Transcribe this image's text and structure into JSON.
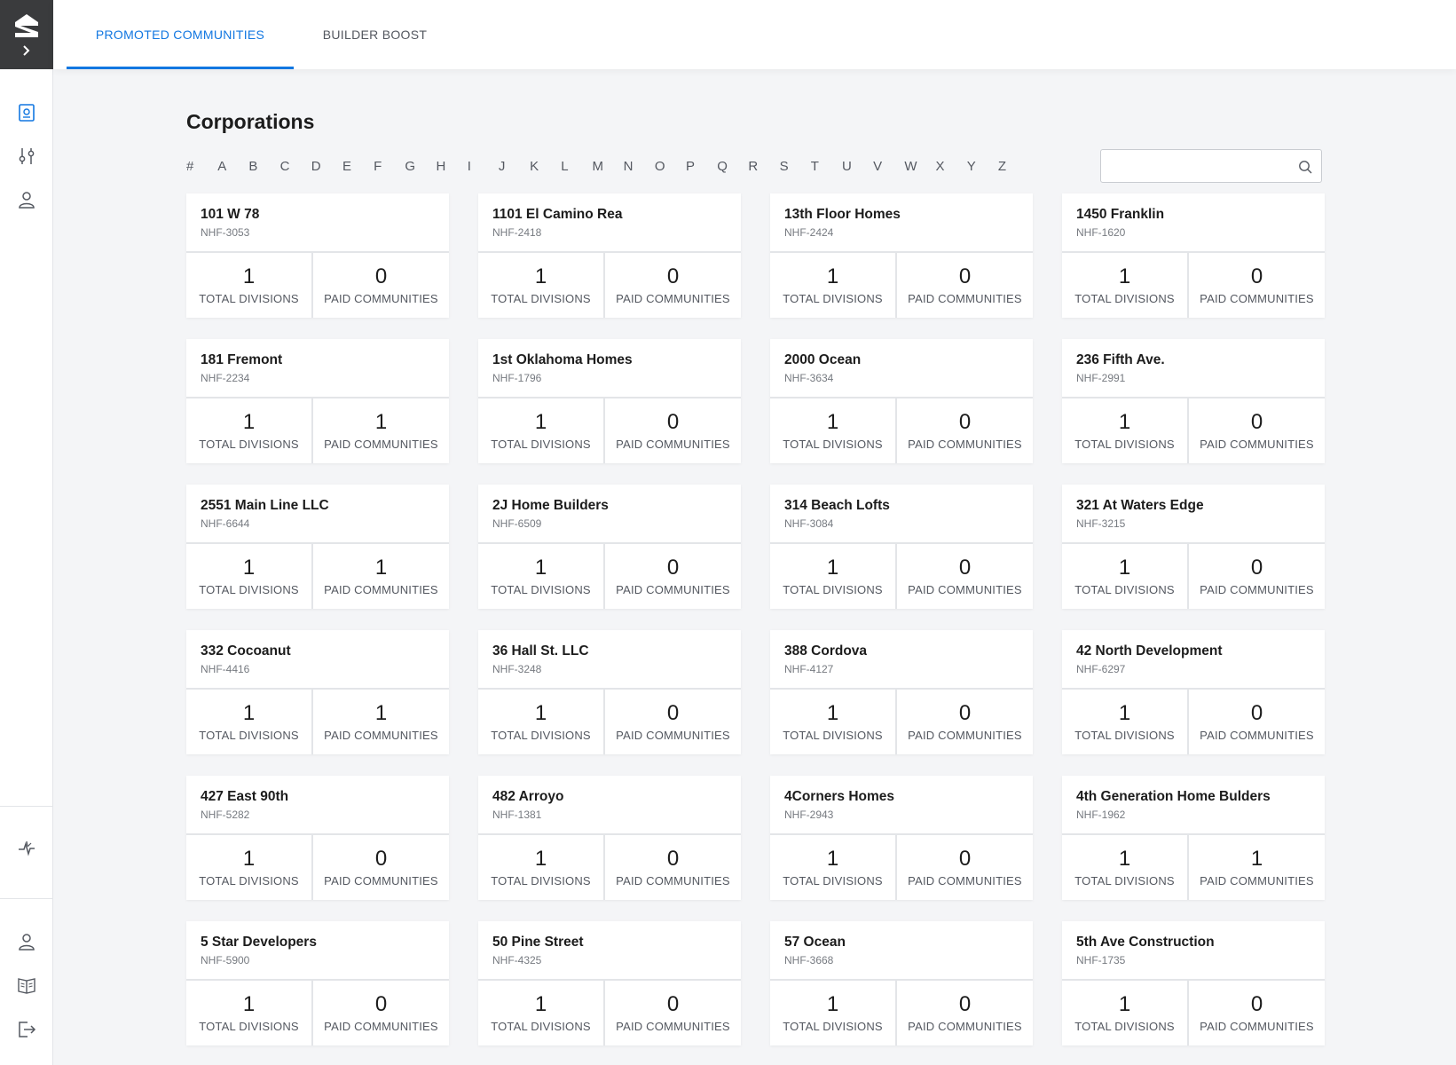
{
  "tabs": [
    {
      "label": "PROMOTED COMMUNITIES",
      "active": true
    },
    {
      "label": "BUILDER BOOST",
      "active": false
    }
  ],
  "page_title": "Corporations",
  "alphabet": [
    "#",
    "A",
    "B",
    "C",
    "D",
    "E",
    "F",
    "G",
    "H",
    "I",
    "J",
    "K",
    "L",
    "M",
    "N",
    "O",
    "P",
    "Q",
    "R",
    "S",
    "T",
    "U",
    "V",
    "W",
    "X",
    "Y",
    "Z"
  ],
  "search": {
    "placeholder": "",
    "value": ""
  },
  "sidebar": {
    "top_icons": [
      "dashboard-icon",
      "filters-icon",
      "users-icon"
    ],
    "middle_icons": [
      "activity-icon"
    ],
    "bottom_icons": [
      "profile-icon",
      "guide-icon",
      "logout-icon"
    ]
  },
  "labels": {
    "total_divisions": "TOTAL DIVISIONS",
    "paid_communities": "PAID COMMUNITIES"
  },
  "colors": {
    "accent": "#1277e1",
    "brand_bg": "#3a3b3d"
  },
  "corporations": [
    {
      "name": "101 W 78",
      "id": "NHF-3053",
      "total_divisions": "1",
      "paid_communities": "0"
    },
    {
      "name": "1101 El Camino Rea",
      "id": "NHF-2418",
      "total_divisions": "1",
      "paid_communities": "0"
    },
    {
      "name": "13th Floor Homes",
      "id": "NHF-2424",
      "total_divisions": "1",
      "paid_communities": "0"
    },
    {
      "name": "1450 Franklin",
      "id": "NHF-1620",
      "total_divisions": "1",
      "paid_communities": "0"
    },
    {
      "name": "181 Fremont",
      "id": "NHF-2234",
      "total_divisions": "1",
      "paid_communities": "1"
    },
    {
      "name": "1st Oklahoma Homes",
      "id": "NHF-1796",
      "total_divisions": "1",
      "paid_communities": "0"
    },
    {
      "name": "2000 Ocean",
      "id": "NHF-3634",
      "total_divisions": "1",
      "paid_communities": "0"
    },
    {
      "name": "236 Fifth Ave.",
      "id": "NHF-2991",
      "total_divisions": "1",
      "paid_communities": "0"
    },
    {
      "name": "2551 Main Line LLC",
      "id": "NHF-6644",
      "total_divisions": "1",
      "paid_communities": "1"
    },
    {
      "name": "2J Home Builders",
      "id": "NHF-6509",
      "total_divisions": "1",
      "paid_communities": "0"
    },
    {
      "name": "314 Beach Lofts",
      "id": "NHF-3084",
      "total_divisions": "1",
      "paid_communities": "0"
    },
    {
      "name": "321 At Waters Edge",
      "id": "NHF-3215",
      "total_divisions": "1",
      "paid_communities": "0"
    },
    {
      "name": "332 Cocoanut",
      "id": "NHF-4416",
      "total_divisions": "1",
      "paid_communities": "1"
    },
    {
      "name": "36 Hall St. LLC",
      "id": "NHF-3248",
      "total_divisions": "1",
      "paid_communities": "0"
    },
    {
      "name": "388 Cordova",
      "id": "NHF-4127",
      "total_divisions": "1",
      "paid_communities": "0"
    },
    {
      "name": "42 North Development",
      "id": "NHF-6297",
      "total_divisions": "1",
      "paid_communities": "0"
    },
    {
      "name": "427 East 90th",
      "id": "NHF-5282",
      "total_divisions": "1",
      "paid_communities": "0"
    },
    {
      "name": "482 Arroyo",
      "id": "NHF-1381",
      "total_divisions": "1",
      "paid_communities": "0"
    },
    {
      "name": "4Corners Homes",
      "id": "NHF-2943",
      "total_divisions": "1",
      "paid_communities": "0"
    },
    {
      "name": "4th Generation Home Bulders",
      "id": "NHF-1962",
      "total_divisions": "1",
      "paid_communities": "1"
    },
    {
      "name": "5 Star Developers",
      "id": "NHF-5900",
      "total_divisions": "1",
      "paid_communities": "0"
    },
    {
      "name": "50 Pine Street",
      "id": "NHF-4325",
      "total_divisions": "1",
      "paid_communities": "0"
    },
    {
      "name": "57 Ocean",
      "id": "NHF-3668",
      "total_divisions": "1",
      "paid_communities": "0"
    },
    {
      "name": "5th Ave Construction",
      "id": "NHF-1735",
      "total_divisions": "1",
      "paid_communities": "0"
    }
  ]
}
